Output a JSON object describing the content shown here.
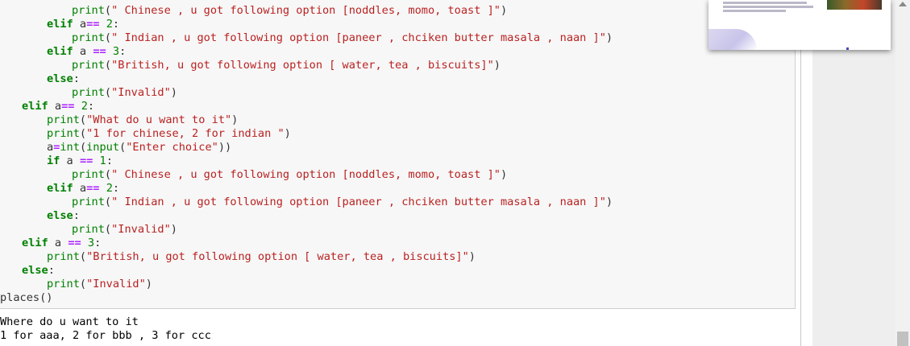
{
  "code_cell": {
    "lines": [
      [
        [
          "    ",
          "plain"
        ],
        [
          "print",
          "bi"
        ],
        [
          "(",
          "plain"
        ],
        [
          "\" Chinese , u got following option [noddles, momo, toast ]\"",
          "str"
        ],
        [
          ")",
          "plain"
        ]
      ],
      [
        [
          "  ",
          "plain"
        ],
        [
          "elif",
          "kw"
        ],
        [
          " a",
          "plain"
        ],
        [
          "==",
          "op"
        ],
        [
          " ",
          "plain"
        ],
        [
          "2",
          "num"
        ],
        [
          ":",
          "plain"
        ]
      ],
      [
        [
          "    ",
          "plain"
        ],
        [
          "print",
          "bi"
        ],
        [
          "(",
          "plain"
        ],
        [
          "\" Indian , u got following option [paneer , chciken butter masala , naan ]\"",
          "str"
        ],
        [
          ")",
          "plain"
        ]
      ],
      [
        [
          "  ",
          "plain"
        ],
        [
          "elif",
          "kw"
        ],
        [
          " a ",
          "plain"
        ],
        [
          "==",
          "op"
        ],
        [
          " ",
          "plain"
        ],
        [
          "3",
          "num"
        ],
        [
          ":",
          "plain"
        ]
      ],
      [
        [
          "    ",
          "plain"
        ],
        [
          "print",
          "bi"
        ],
        [
          "(",
          "plain"
        ],
        [
          "\"British, u got following option [ water, tea , biscuits]\"",
          "str"
        ],
        [
          ")",
          "plain"
        ]
      ],
      [
        [
          "  ",
          "plain"
        ],
        [
          "else",
          "kw"
        ],
        [
          ":",
          "plain"
        ]
      ],
      [
        [
          "    ",
          "plain"
        ],
        [
          "print",
          "bi"
        ],
        [
          "(",
          "plain"
        ],
        [
          "\"Invalid\"",
          "str"
        ],
        [
          ")",
          "plain"
        ]
      ],
      [
        [
          "elif",
          "kw"
        ],
        [
          " a",
          "plain"
        ],
        [
          "==",
          "op"
        ],
        [
          " ",
          "plain"
        ],
        [
          "2",
          "num"
        ],
        [
          ":",
          "plain"
        ]
      ],
      [
        [
          "  ",
          "plain"
        ],
        [
          "print",
          "bi"
        ],
        [
          "(",
          "plain"
        ],
        [
          "\"What do u want to it\"",
          "str"
        ],
        [
          ")",
          "plain"
        ]
      ],
      [
        [
          "  ",
          "plain"
        ],
        [
          "print",
          "bi"
        ],
        [
          "(",
          "plain"
        ],
        [
          "\"1 for chinese, 2 for indian \"",
          "str"
        ],
        [
          ")",
          "plain"
        ]
      ],
      [
        [
          "  a",
          "plain"
        ],
        [
          "=",
          "op"
        ],
        [
          "int",
          "bi"
        ],
        [
          "(",
          "plain"
        ],
        [
          "input",
          "bi"
        ],
        [
          "(",
          "plain"
        ],
        [
          "\"Enter choice\"",
          "str"
        ],
        [
          "))",
          "plain"
        ]
      ],
      [
        [
          "  ",
          "plain"
        ],
        [
          "if",
          "kw"
        ],
        [
          " a ",
          "plain"
        ],
        [
          "==",
          "op"
        ],
        [
          " ",
          "plain"
        ],
        [
          "1",
          "num"
        ],
        [
          ":",
          "plain"
        ]
      ],
      [
        [
          "    ",
          "plain"
        ],
        [
          "print",
          "bi"
        ],
        [
          "(",
          "plain"
        ],
        [
          "\" Chinese , u got following option [noddles, momo, toast ]\"",
          "str"
        ],
        [
          ")",
          "plain"
        ]
      ],
      [
        [
          "  ",
          "plain"
        ],
        [
          "elif",
          "kw"
        ],
        [
          " a",
          "plain"
        ],
        [
          "==",
          "op"
        ],
        [
          " ",
          "plain"
        ],
        [
          "2",
          "num"
        ],
        [
          ":",
          "plain"
        ]
      ],
      [
        [
          "    ",
          "plain"
        ],
        [
          "print",
          "bi"
        ],
        [
          "(",
          "plain"
        ],
        [
          "\" Indian , u got following option [paneer , chciken butter masala , naan ]\"",
          "str"
        ],
        [
          ")",
          "plain"
        ]
      ],
      [
        [
          "  ",
          "plain"
        ],
        [
          "else",
          "kw"
        ],
        [
          ":",
          "plain"
        ]
      ],
      [
        [
          "    ",
          "plain"
        ],
        [
          "print",
          "bi"
        ],
        [
          "(",
          "plain"
        ],
        [
          "\"Invalid\"",
          "str"
        ],
        [
          ")",
          "plain"
        ]
      ],
      [
        [
          "elif",
          "kw"
        ],
        [
          " a ",
          "plain"
        ],
        [
          "==",
          "op"
        ],
        [
          " ",
          "plain"
        ],
        [
          "3",
          "num"
        ],
        [
          ":",
          "plain"
        ]
      ],
      [
        [
          "  ",
          "plain"
        ],
        [
          "print",
          "bi"
        ],
        [
          "(",
          "plain"
        ],
        [
          "\"British, u got following option [ water, tea , biscuits]\"",
          "str"
        ],
        [
          ")",
          "plain"
        ]
      ],
      [
        [
          "else",
          "kw"
        ],
        [
          ":",
          "plain"
        ]
      ],
      [
        [
          "  ",
          "plain"
        ],
        [
          "print",
          "bi"
        ],
        [
          "(",
          "plain"
        ],
        [
          "\"Invalid\"",
          "str"
        ],
        [
          ")",
          "plain"
        ]
      ],
      [
        [
          "places()",
          "plain"
        ]
      ]
    ]
  },
  "output": {
    "lines": [
      "Where do u want to it",
      "1 for aaa, 2 for bbb , 3 for ccc"
    ]
  },
  "colors": {
    "keyword": "#008000",
    "string": "#ba2121",
    "operator": "#aa22ff",
    "cell_background": "#f7f7f7"
  }
}
